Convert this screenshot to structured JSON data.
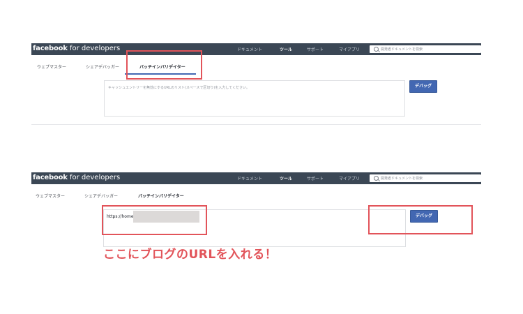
{
  "header": {
    "brand_bold": "facebook",
    "brand_rest": " for developers",
    "nav": [
      "ドキュメント",
      "ツール",
      "サポート",
      "マイアプリ"
    ],
    "active_nav": "ツール",
    "search_placeholder": "開発者ドキュメントを検索",
    "search_icon": "search-icon"
  },
  "tabs": [
    "ウェブマスター",
    "シェアデバッガー",
    "バッチインバリデイター"
  ],
  "active_tab": "バッチインバリデイター",
  "form": {
    "placeholder": "キャッシュエントリーを無効にするURLのリスト(スペースで区切り)を入力してください。",
    "entered_url": "https://homepa",
    "debug_button": "デバッグ"
  },
  "annotation": "ここにブログのURLを入れる！",
  "colors": {
    "topbar": "#3b4755",
    "button": "#4267b2",
    "highlight": "#e2545a"
  }
}
